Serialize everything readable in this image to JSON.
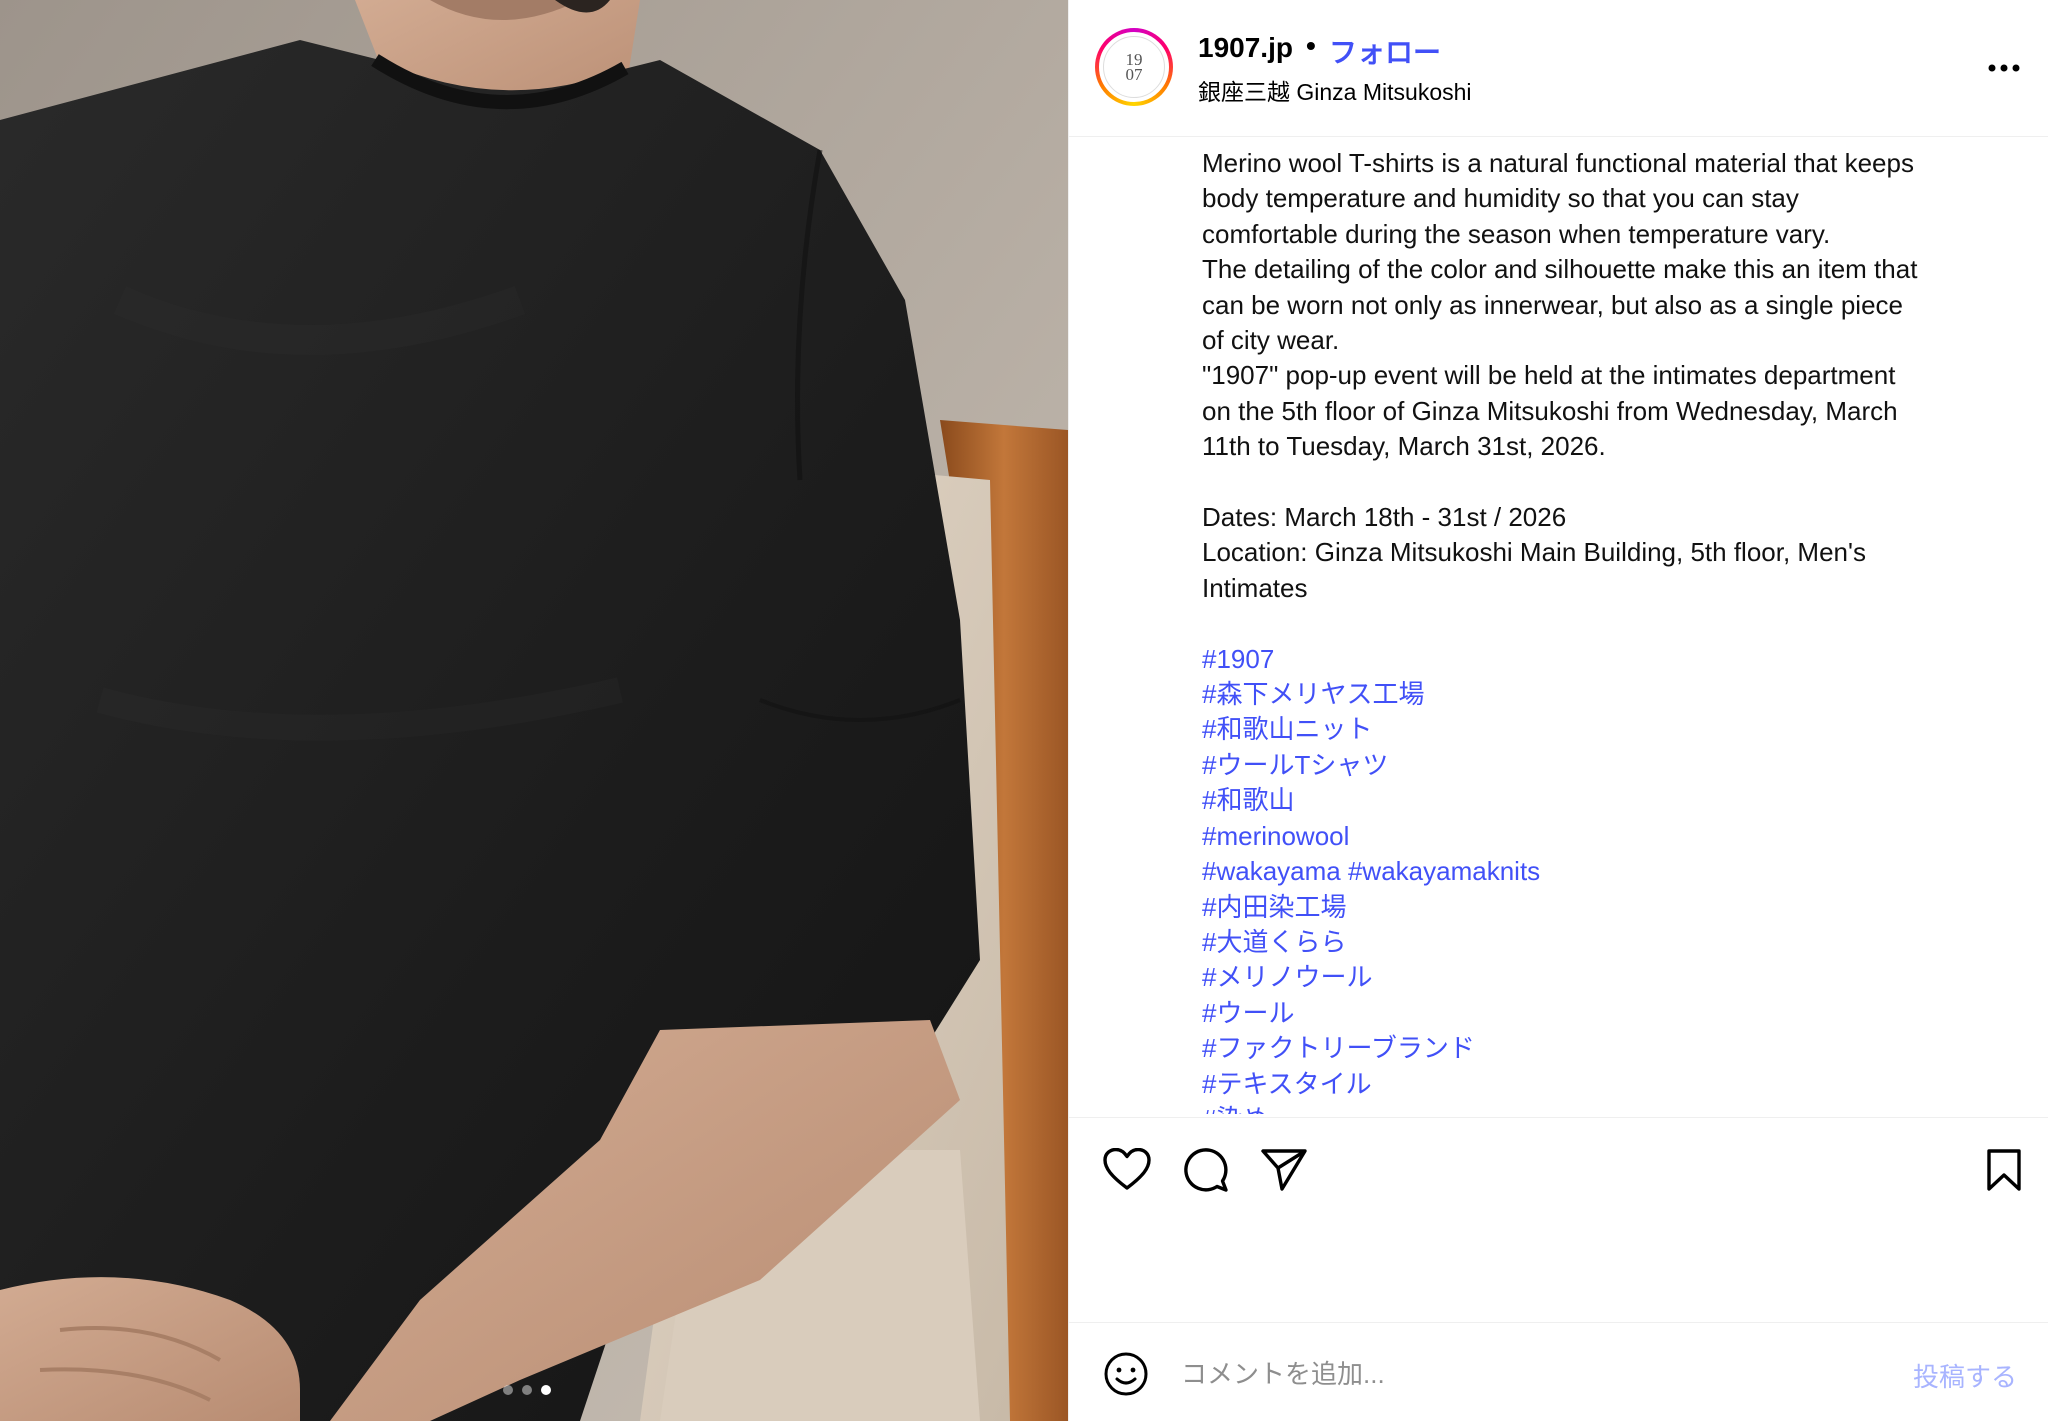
{
  "post": {
    "username": "1907.jp",
    "separator": "•",
    "follow_label": "フォロー",
    "location": "銀座三越 Ginza Mitsukoshi",
    "avatar_logo_top": "19",
    "avatar_logo_bottom": "07",
    "more_icon": "more-horizontal-icon"
  },
  "media": {
    "description_colors": {
      "shirt": "#1f1f1f",
      "chair_fabric": "#d8cbbb",
      "wood": "#b86a2e",
      "wall": "#b8aea4",
      "skin": "#c7a28a"
    },
    "carousel": {
      "count": 3,
      "active_index": 2
    }
  },
  "caption": {
    "body_lines": [
      "Merino wool T-shirts is a natural functional material that keeps",
      "body temperature and humidity so that you can stay",
      "comfortable during the season when temperature vary.",
      "The detailing of the color and silhouette make this an item that",
      "can be worn not only as innerwear, but also as a single piece",
      "of city wear.",
      "\"1907\" pop-up event will be held at the intimates department",
      "on the 5th floor of Ginza Mitsukoshi from Wednesday, March",
      "11th to Tuesday, March 31st, 2026."
    ],
    "details_lines": [
      "Dates: March 18th - 31st / 2026",
      "Location: Ginza Mitsukoshi Main Building, 5th floor, Men's",
      "Intimates"
    ],
    "hashtags": [
      "#1907",
      "#森下メリヤス工場",
      "#和歌山ニット",
      "#ウールTシャツ",
      "#和歌山",
      "#merinowool"
    ],
    "hashtag_pair": [
      "#wakayama",
      "#wakayamaknits"
    ],
    "hashtags_more": [
      "#内田染工場",
      "#大道くらら",
      "#メリノウール",
      "#ウール",
      "#ファクトリーブランド",
      "#テキスタイル",
      "#染め"
    ]
  },
  "actions": {
    "like_icon": "heart-icon",
    "comment_icon": "comment-icon",
    "share_icon": "paper-plane-icon",
    "save_icon": "bookmark-icon"
  },
  "comment": {
    "placeholder": "コメントを追加...",
    "post_label": "投稿する",
    "emoji_icon": "emoji-icon"
  },
  "colors": {
    "link_blue": "#4150f7",
    "post_button_disabled": "#a8b4ff",
    "divider": "#efefef"
  }
}
